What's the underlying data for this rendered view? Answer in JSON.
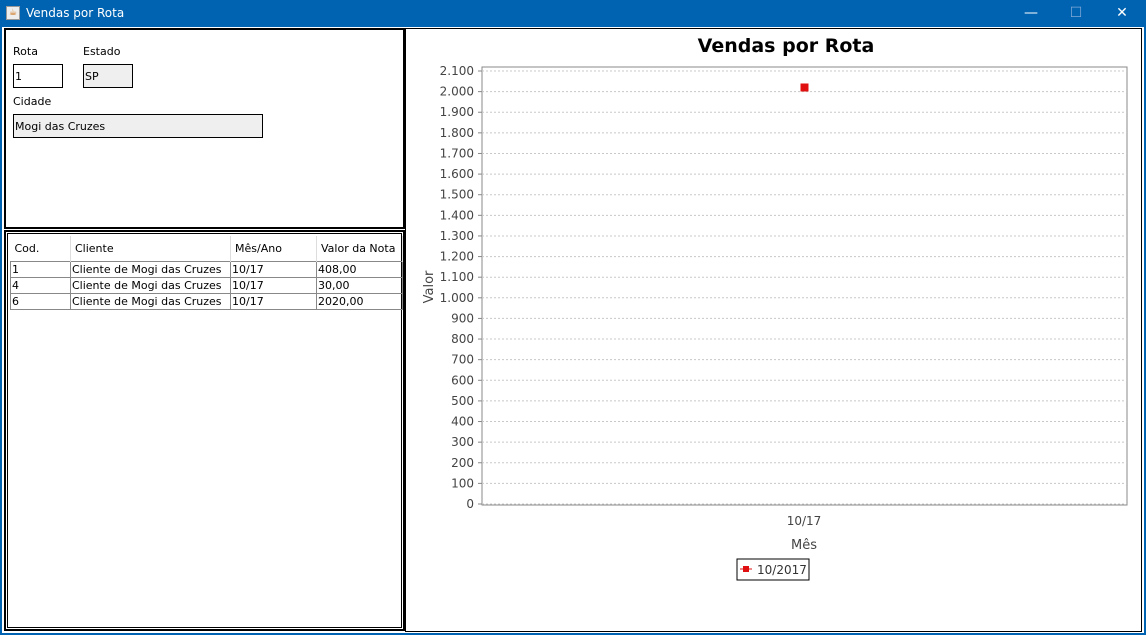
{
  "window": {
    "title": "Vendas por Rota",
    "minimize": "—",
    "maximize": "☐",
    "close": "✕"
  },
  "form": {
    "rota_label": "Rota",
    "rota_value": "1",
    "estado_label": "Estado",
    "estado_value": "SP",
    "cidade_label": "Cidade",
    "cidade_value": "Mogi das Cruzes"
  },
  "table": {
    "headers": [
      "Cod.",
      "Cliente",
      "Mês/Ano",
      "Valor da Nota"
    ],
    "rows": [
      [
        "1",
        "Cliente de Mogi das Cruzes",
        "10/17",
        "408,00"
      ],
      [
        "4",
        "Cliente de Mogi das Cruzes",
        "10/17",
        "30,00"
      ],
      [
        "6",
        "Cliente de Mogi das Cruzes",
        "10/17",
        "2020,00"
      ]
    ]
  },
  "chart_data": {
    "type": "line",
    "title": "Vendas por Rota",
    "xlabel": "Mês",
    "ylabel": "Valor",
    "categories": [
      "10/17"
    ],
    "series": [
      {
        "name": "10/2017",
        "values": [
          2020
        ],
        "color": "#e01010"
      }
    ],
    "ylim": [
      0,
      2100
    ],
    "yticks": [
      0,
      100,
      200,
      300,
      400,
      500,
      600,
      700,
      800,
      900,
      1000,
      1100,
      1200,
      1300,
      1400,
      1500,
      1600,
      1700,
      1800,
      1900,
      2000,
      2100
    ],
    "ytick_labels": [
      "0",
      "100",
      "200",
      "300",
      "400",
      "500",
      "600",
      "700",
      "800",
      "900",
      "1.000",
      "1.100",
      "1.200",
      "1.300",
      "1.400",
      "1.500",
      "1.600",
      "1.700",
      "1.800",
      "1.900",
      "2.000",
      "2.100"
    ],
    "grid": true,
    "legend": "bottom"
  }
}
